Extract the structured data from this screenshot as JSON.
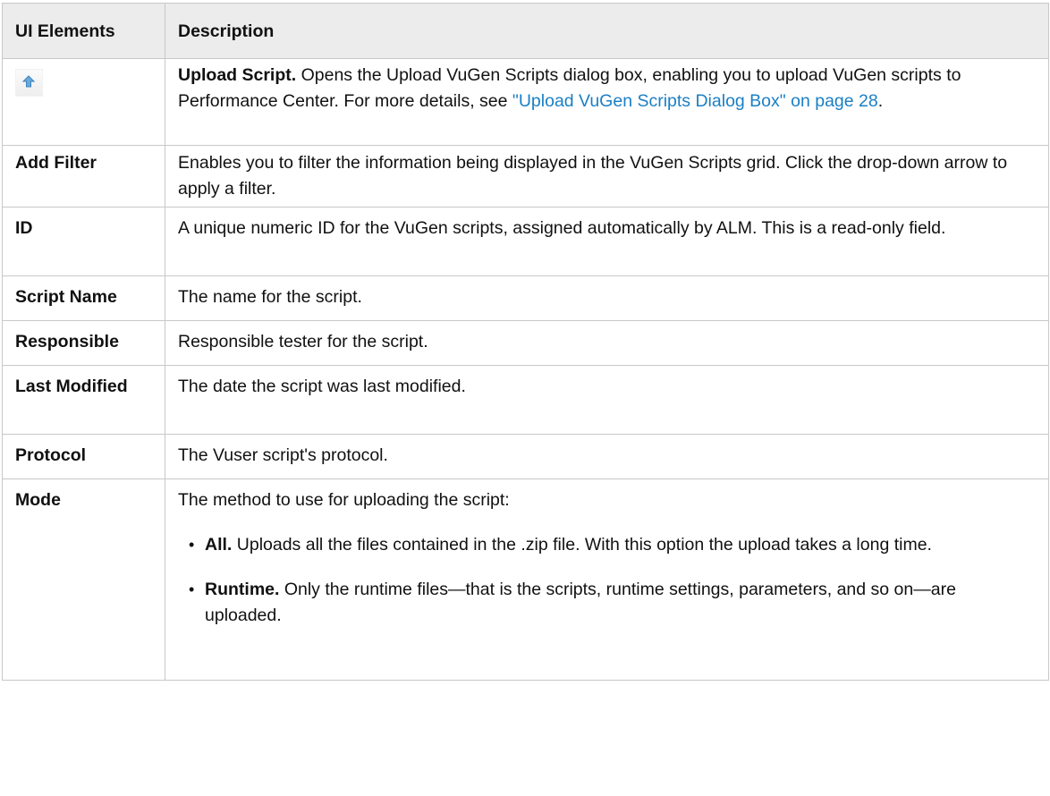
{
  "table": {
    "header": {
      "col1": "UI Elements",
      "col2": "Description"
    },
    "rows": {
      "upload": {
        "icon": "upload-arrow-icon",
        "title": "Upload Script.",
        "text": " Opens the Upload VuGen Scripts dialog box, enabling you to upload VuGen scripts to Performance Center. For more details, see ",
        "link": "\"Upload VuGen Scripts Dialog Box\" on page 28",
        "after": "."
      },
      "filter": {
        "label": "Add Filter",
        "desc": "Enables you to filter the information being displayed in the VuGen Scripts grid. Click the drop-down arrow to apply a filter."
      },
      "id": {
        "label": "ID",
        "desc": "A unique numeric ID for the VuGen scripts, assigned automatically by ALM. This is a read-only field."
      },
      "script_name": {
        "label": "Script Name",
        "desc": "The name for the script."
      },
      "responsible": {
        "label": "Responsible",
        "desc": "Responsible tester for the script."
      },
      "last_modified": {
        "label": "Last Modified",
        "desc": "The date the script was last modified."
      },
      "protocol": {
        "label": "Protocol",
        "desc": "The Vuser script's protocol."
      },
      "mode": {
        "label": "Mode",
        "intro": "The method to use for uploading the script:",
        "all_title": "All.",
        "all_text": " Uploads all the files contained in the .zip file. With this option the upload takes a long time.",
        "runtime_title": "Runtime.",
        "runtime_text": " Only the runtime files—that is the scripts, runtime settings, parameters, and so on—are uploaded."
      }
    }
  },
  "colors": {
    "header_bg": "#ececec",
    "border": "#c8c8c8",
    "link": "#1a7fc4",
    "icon_arrow": "#6aa9d9"
  }
}
